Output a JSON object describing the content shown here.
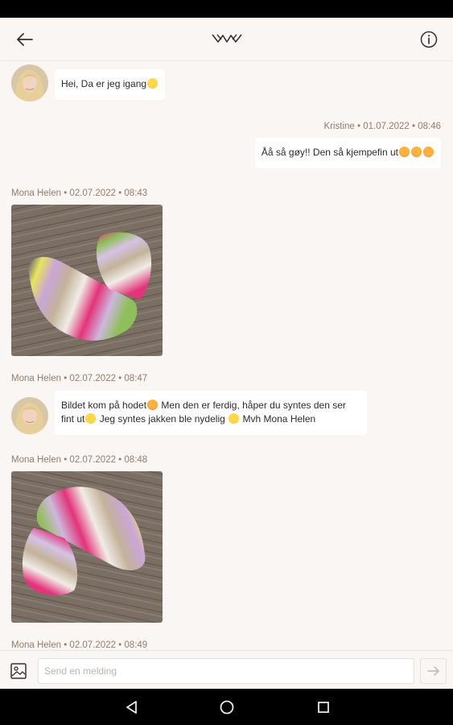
{
  "header": {
    "back_icon": "arrow-left-icon",
    "logo_icon": "brand-logo-icon",
    "info_icon": "info-icon"
  },
  "messages": {
    "m1": {
      "text": "Hei, Da er jeg igang",
      "emoji": "sun"
    },
    "m2": {
      "meta": "Kristine • 01.07.2022 • 08:46",
      "text": "Åå så gøy!! Den så kjempefin ut",
      "emoji": [
        "heart",
        "heart",
        "heart"
      ]
    },
    "m3": {
      "meta": "Mona Helen • 02.07.2022 • 08:43",
      "image": "knitted-socks-photo"
    },
    "m4": {
      "meta": "Mona Helen • 02.07.2022 • 08:47",
      "line1_a": "Bildet kom på hodet",
      "line1_b": " Men den er ferdig, håper du syntes den ser",
      "line2_a": "fint ut",
      "line2_b": " Jeg syntes jakken ble nydelig ",
      "line2_c": " Mvh Mona Helen"
    },
    "m5": {
      "meta": "Mona Helen • 02.07.2022 • 08:48",
      "image": "knitted-socks-photo"
    },
    "m6": {
      "meta": "Mona Helen • 02.07.2022 • 08:49"
    }
  },
  "composer": {
    "image_icon": "image-attach-icon",
    "placeholder": "Send en melding",
    "value": "",
    "send_icon": "send-arrow-icon"
  },
  "navbar": {
    "back_icon": "nav-back-icon",
    "home_icon": "nav-home-icon",
    "recents_icon": "nav-recents-icon"
  },
  "colors": {
    "background": "#f9f6f3",
    "meta_text": "#9a7b6a",
    "bubble": "#ffffff",
    "system_bar": "#000000"
  }
}
